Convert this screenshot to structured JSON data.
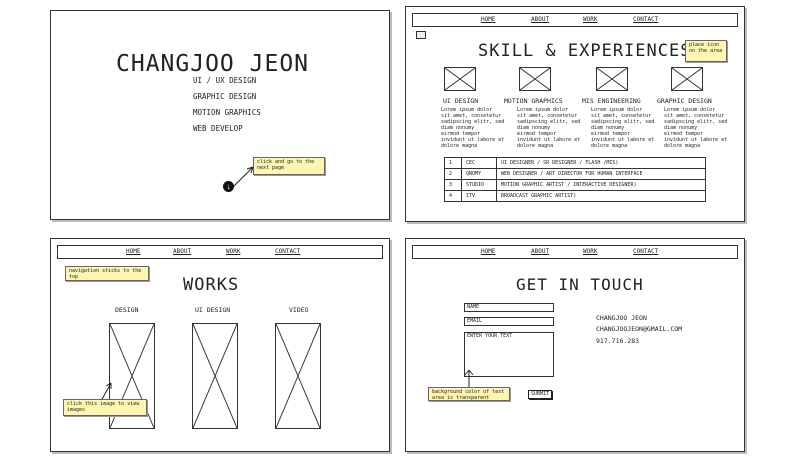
{
  "nav": {
    "home": "HOME",
    "about": "ABOUT",
    "work": "WORK",
    "contact": "CONTACT"
  },
  "p1": {
    "name": "CHANGJOO JEON",
    "menu": [
      "UI / UX DESIGN",
      "GRAPHIC DESIGN",
      "MOTION GRAPHICS",
      "WEB DEVELOP"
    ],
    "note": "click and go to the next page",
    "down_icon": "down-arrow-circle"
  },
  "p2": {
    "title": "SKILL & EXPERIENCES",
    "note": "place icon on the area",
    "skills": [
      "UI DESIGN",
      "MOTION GRAPHICS",
      "MIS ENGINEERING",
      "GRAPHIC DESIGN"
    ],
    "lorem": "Lorem ipsum dolor\nsit amet, consetetur\nsadipscing elitr, sed\ndiam nonumy\neirmod tempor\ninvidunt ut labore et\ndolore magna",
    "table": [
      [
        "1",
        "CEC",
        "UI DESIGNER / SR DESIGNER / FLASH /MIS)"
      ],
      [
        "2",
        "QNOMY",
        "WEB DESIGNER / ART DIRECTOR FOR HUMAN INTERFACE"
      ],
      [
        "3",
        "STUDIO",
        "MOTION GRAPHIC ARTIST / INTERACTIVE DESIGNER)"
      ],
      [
        "4",
        "ITV",
        "BROADCAST GRAPHIC ARTIST)"
      ]
    ]
  },
  "p3": {
    "title": "WORKS",
    "note_nav": "navigation sticks to the top",
    "note_img": "click this image to view images",
    "categories": [
      "DESIGN",
      "UI DESIGN",
      "VIDEO"
    ]
  },
  "p4": {
    "title": "GET IN TOUCH",
    "name_label": "NAME",
    "email_label": "EMAIL",
    "text_label": "ENTER YOUR TEXT",
    "note": "background color of text area is transparent",
    "submit": "SUBMIT",
    "contact_name": "CHANGJOO JEON",
    "contact_email": "CHANGJOOJEON@GMAIL.COM",
    "contact_phone": "917.716.283"
  }
}
